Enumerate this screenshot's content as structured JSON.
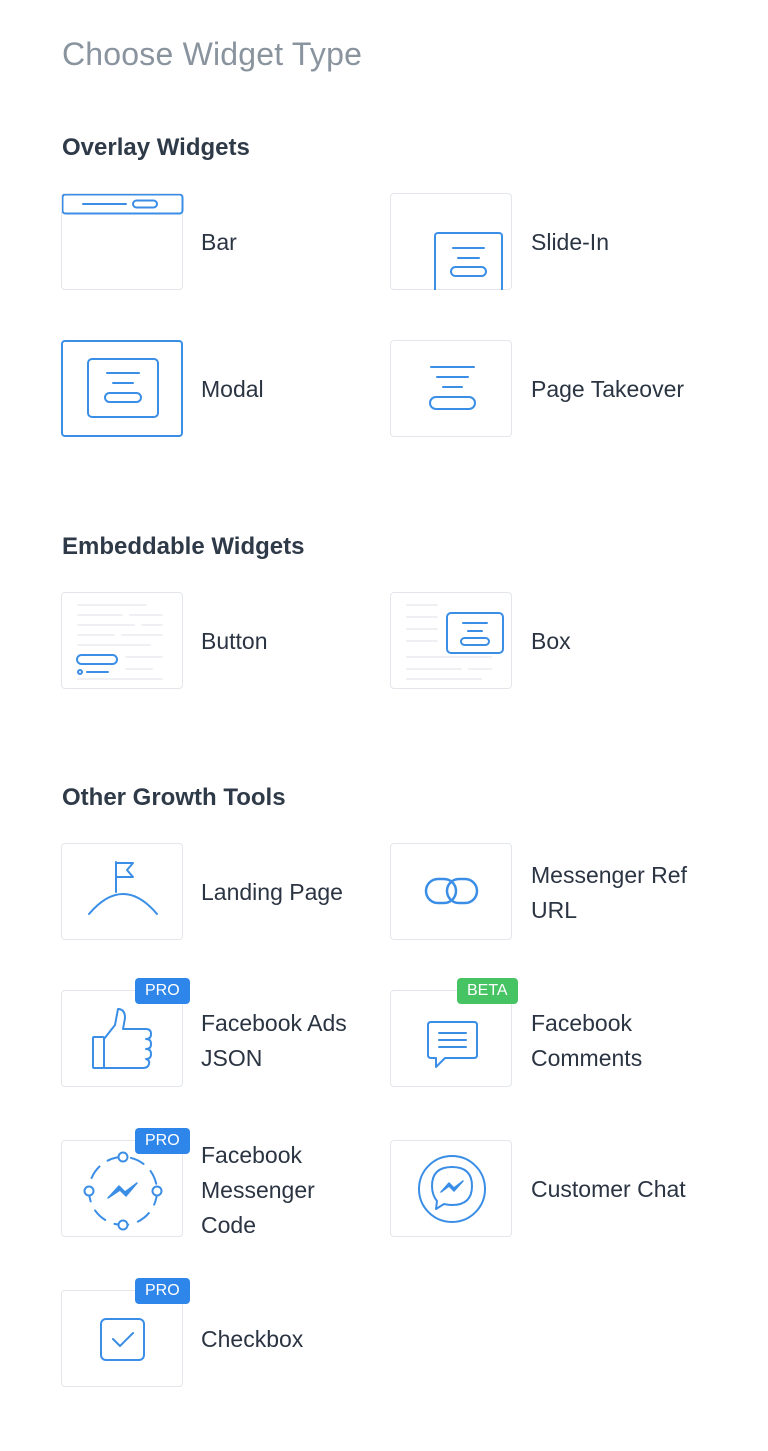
{
  "page_title": "Choose Widget Type",
  "sections": {
    "overlay": {
      "title": "Overlay Widgets",
      "items": {
        "bar": "Bar",
        "slide_in": "Slide-In",
        "modal": "Modal",
        "page_takeover": "Page Takeover"
      }
    },
    "embeddable": {
      "title": "Embeddable Widgets",
      "items": {
        "button": "Button",
        "box": "Box"
      }
    },
    "other": {
      "title": "Other Growth Tools",
      "items": {
        "landing_page": "Landing Page",
        "messenger_ref_url_1": "Messenger Ref",
        "messenger_ref_url_2": "URL",
        "facebook_ads_json_1": "Facebook Ads",
        "facebook_ads_json_2": "JSON",
        "facebook_comments_1": "Facebook",
        "facebook_comments_2": "Comments",
        "facebook_messenger_code_1": "Facebook",
        "facebook_messenger_code_2": "Messenger",
        "facebook_messenger_code_3": "Code",
        "customer_chat": "Customer Chat",
        "checkbox": "Checkbox"
      }
    }
  },
  "badges": {
    "pro": "PRO",
    "beta": "BETA"
  },
  "colors": {
    "accent": "#3b8ee6",
    "pro_badge": "#2e86ea",
    "beta_badge": "#46c363",
    "tile_border": "#e3e6ea",
    "title_muted": "#8a949f"
  },
  "selected_widget": "Modal"
}
